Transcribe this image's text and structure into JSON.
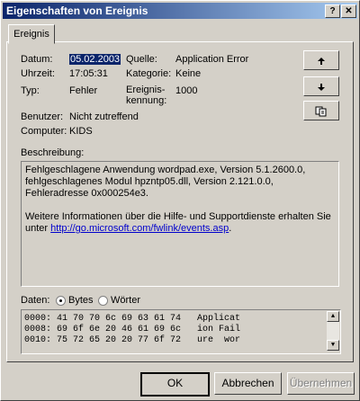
{
  "window": {
    "title": "Eigenschaften von Ereignis",
    "help_button": "?",
    "close_button": "✕"
  },
  "tabs": [
    {
      "label": "Ereignis"
    }
  ],
  "fields": {
    "datum_label": "Datum:",
    "datum_value": "05.02.2003",
    "uhrzeit_label": "Uhrzeit:",
    "uhrzeit_value": "17:05:31",
    "typ_label": "Typ:",
    "typ_value": "Fehler",
    "benutzer_label": "Benutzer:",
    "benutzer_value": "Nicht zutreffend",
    "computer_label": "Computer:",
    "computer_value": "KIDS",
    "quelle_label": "Quelle:",
    "quelle_value": "Application Error",
    "kategorie_label": "Kategorie:",
    "kategorie_value": "Keine",
    "ereignis_label_1": "Ereignis-",
    "ereignis_label_2": "kennung:",
    "ereignis_value": "1000"
  },
  "nav_buttons": {
    "up_icon": "arrow-up",
    "down_icon": "arrow-down",
    "copy_icon": "copy"
  },
  "description": {
    "label": "Beschreibung:",
    "text1": "Fehlgeschlagene Anwendung wordpad.exe, Version 5.1.2600.0, fehlgeschlagenes Modul hpzntp05.dll, Version 2.121.0.0, Fehleradresse 0x000254e3.",
    "text2_prefix": "Weitere Informationen über die Hilfe- und Supportdienste erhalten Sie unter ",
    "link": "http://go.microsoft.com/fwlink/events.asp",
    "text2_suffix": "."
  },
  "data_section": {
    "label": "Daten:",
    "bytes_label": "Bytes",
    "words_label": "Wörter",
    "selected": "Bytes",
    "lines": [
      "0000: 41 70 70 6c 69 63 61 74   Applicat",
      "0008: 69 6f 6e 20 46 61 69 6c   ion Fail",
      "0010: 75 72 65 20 20 77 6f 72   ure  wor"
    ]
  },
  "buttons": {
    "ok": "OK",
    "cancel": "Abbrechen",
    "apply": "Übernehmen"
  }
}
